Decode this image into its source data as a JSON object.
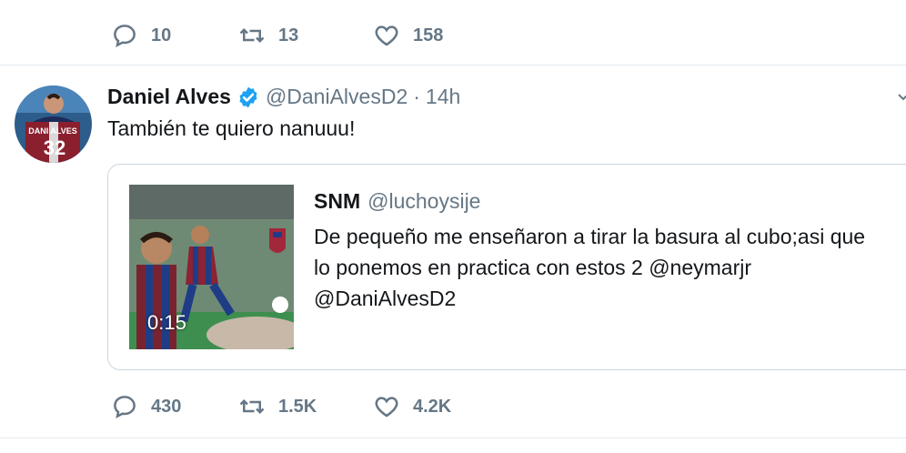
{
  "previous_tweet": {
    "actions": {
      "reply_count": "10",
      "retweet_count": "13",
      "like_count": "158"
    }
  },
  "tweet": {
    "author": {
      "name": "Daniel Alves",
      "handle": "@DaniAlvesD2",
      "verified": true,
      "avatar_shirt_text": "DANI ALVES",
      "avatar_shirt_number": "32"
    },
    "separator": "·",
    "time": "14h",
    "text": "También te quiero nanuuu!",
    "quoted": {
      "name": "SNM",
      "handle": "@luchoysije",
      "lines": [
        "De pequeño me enseñaron a tirar la basura al cubo;asi que",
        "lo ponemos en practica con estos 2 @neymarjr",
        "@DaniAlvesD2"
      ],
      "video_duration": "0:15"
    },
    "actions": {
      "reply_count": "430",
      "retweet_count": "1.5K",
      "like_count": "4.2K"
    }
  },
  "colors": {
    "text_primary": "#14171a",
    "text_secondary": "#657786",
    "verified_blue": "#1da1f2",
    "border": "#ccd6dd"
  },
  "icons": {
    "reply": "reply-icon",
    "retweet": "retweet-icon",
    "like": "heart-icon",
    "verified": "verified-badge-icon",
    "caret": "chevron-down-icon"
  }
}
